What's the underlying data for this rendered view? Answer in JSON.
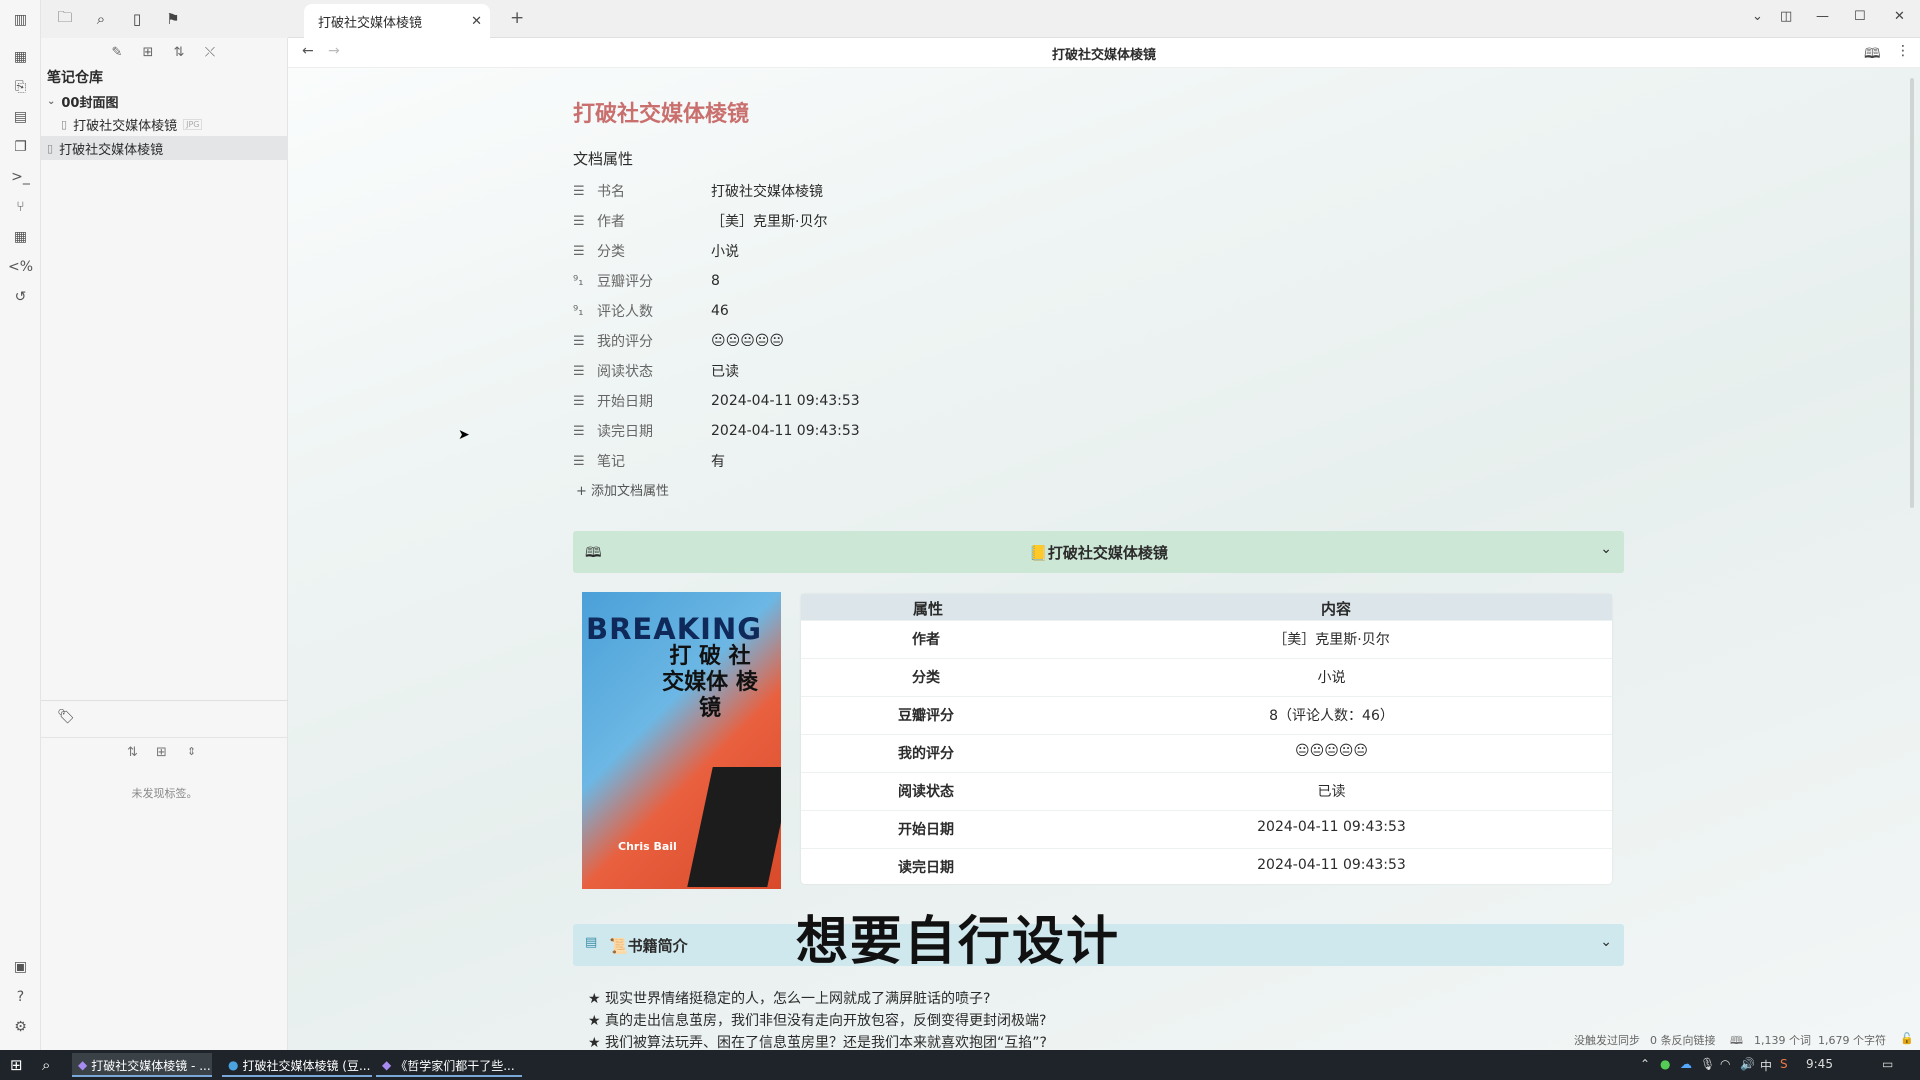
{
  "ribbon": {
    "icons": [
      "dashboard-icon",
      "file-import-icon",
      "calendar-icon",
      "copy-icon",
      "terminal-icon",
      "graph-icon",
      "table-icon",
      "code-icon",
      "history-icon",
      "help-doc-icon",
      "help-icon",
      "settings-icon"
    ]
  },
  "sidebar": {
    "vault_name": "笔记仓库",
    "tree": [
      {
        "label": "00封面图",
        "type": "folder"
      },
      {
        "label": "打破社交媒体棱镜",
        "badge": "JPG",
        "type": "image"
      },
      {
        "label": "打破社交媒体棱镜",
        "type": "note"
      }
    ],
    "tags_empty": "未发现标签。"
  },
  "tab": {
    "title": "打破社交媒体棱镜"
  },
  "nav": {
    "title": "打破社交媒体棱镜"
  },
  "doc": {
    "title": "打破社交媒体棱镜",
    "props_title": "文档属性",
    "properties": [
      {
        "key": "书名",
        "value": "打破社交媒体棱镜",
        "icon": "text"
      },
      {
        "key": "作者",
        "value": "［美］克里斯·贝尔",
        "icon": "text"
      },
      {
        "key": "分类",
        "value": "小说",
        "icon": "text"
      },
      {
        "key": "豆瓣评分",
        "value": "8",
        "icon": "number"
      },
      {
        "key": "评论人数",
        "value": "46",
        "icon": "number"
      },
      {
        "key": "我的评分",
        "value": "😐😐😐😐😐",
        "icon": "text"
      },
      {
        "key": "阅读状态",
        "value": "已读",
        "icon": "text"
      },
      {
        "key": "开始日期",
        "value": "2024-04-11 09:43:53",
        "icon": "text"
      },
      {
        "key": "读完日期",
        "value": "2024-04-11 09:43:53",
        "icon": "text"
      },
      {
        "key": "笔记",
        "value": "有",
        "icon": "text"
      }
    ],
    "add_prop": "添加文档属性",
    "callout1_title": "📒打破社交媒体棱镜",
    "cover": {
      "en": "BREAKING",
      "zh": "打 破 社交媒体 棱 镜",
      "author": "Chris Bail"
    },
    "table": {
      "headers": [
        "属性",
        "内容"
      ],
      "rows": [
        {
          "k": "作者",
          "v": "［美］克里斯·贝尔"
        },
        {
          "k": "分类",
          "v": "小说"
        },
        {
          "k": "豆瓣评分",
          "v": "8（评论人数：46）"
        },
        {
          "k": "我的评分",
          "v": "😐😐😐😐😐"
        },
        {
          "k": "阅读状态",
          "v": "已读"
        },
        {
          "k": "开始日期",
          "v": "2024-04-11 09:43:53"
        },
        {
          "k": "读完日期",
          "v": "2024-04-11 09:43:53"
        }
      ]
    },
    "overlay_text": "想要自行设计",
    "callout2_title": "📜书籍简介",
    "bullets": [
      "★ 现实世界情绪挺稳定的人，怎么一上网就成了满屏脏话的喷子?",
      "★ 真的走出信息茧房，我们非但没有走向开放包容，反倒变得更封闭极端?",
      "★ 我们被算法玩弄、困在了信息茧房里？还是我们本来就喜欢抱团“互掐”?"
    ]
  },
  "status": {
    "sync": "没触发过同步",
    "backlinks": "0 条反向链接",
    "words": "1,139 个词",
    "chars": "1,679 个字符"
  },
  "taskbar": {
    "tasks": [
      "打破社交媒体棱镜 - ...",
      "打破社交媒体棱镜 (豆...",
      "《哲学家们都干了些..."
    ],
    "ime": "中",
    "time": "9:45"
  }
}
